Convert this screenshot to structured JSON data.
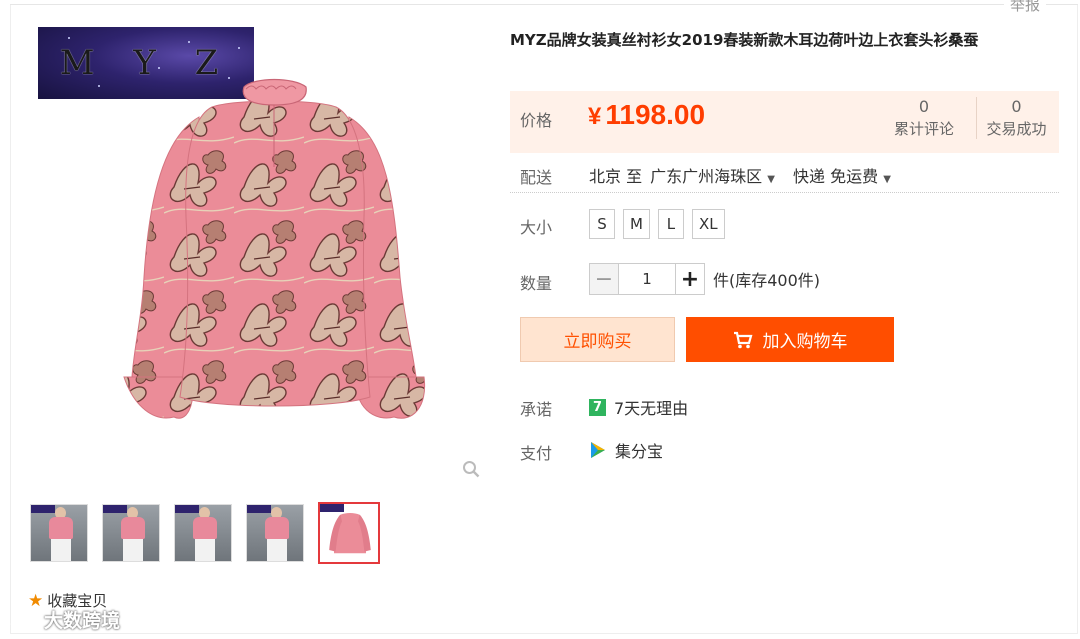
{
  "header": {
    "report_label": "举报"
  },
  "gallery": {
    "brand_logo_text": "M Y Z",
    "zoom_icon": "magnifier-icon",
    "thumbnail_count": 5,
    "active_thumbnail": 5
  },
  "favorite": {
    "icon": "star-icon",
    "label": "收藏宝贝"
  },
  "watermark": {
    "text": "大数跨境"
  },
  "product": {
    "title": "MYZ品牌女装真丝衬衫女2019春装新款木耳边荷叶边上衣套头衫桑蚕",
    "price_label": "价格",
    "currency_symbol": "¥",
    "price": "1198.00",
    "reviews_count": "0",
    "reviews_label": "累计评论",
    "sales_count": "0",
    "sales_label": "交易成功"
  },
  "delivery": {
    "label": "配送",
    "from": "北京 至",
    "to": "广东广州海珠区",
    "shipping": "快递 免运费"
  },
  "size": {
    "label": "大小",
    "options": [
      "S",
      "M",
      "L",
      "XL"
    ]
  },
  "quantity": {
    "label": "数量",
    "value": "1",
    "unit_text": "件(库存400件)"
  },
  "actions": {
    "buy_now": "立即购买",
    "add_to_cart": "加入购物车",
    "cart_icon": "cart-icon"
  },
  "promise": {
    "label": "承诺",
    "badge": "7",
    "text": "7天无理由"
  },
  "payment": {
    "label": "支付",
    "icon": "jifenbao-icon",
    "text": "集分宝"
  },
  "colors": {
    "price": "#ff3d00",
    "add_to_cart_bg": "#ff4e00",
    "buy_now_bg": "#ffe4d0",
    "price_box_bg": "#fff1e9",
    "promise_badge": "#2fb45e"
  }
}
